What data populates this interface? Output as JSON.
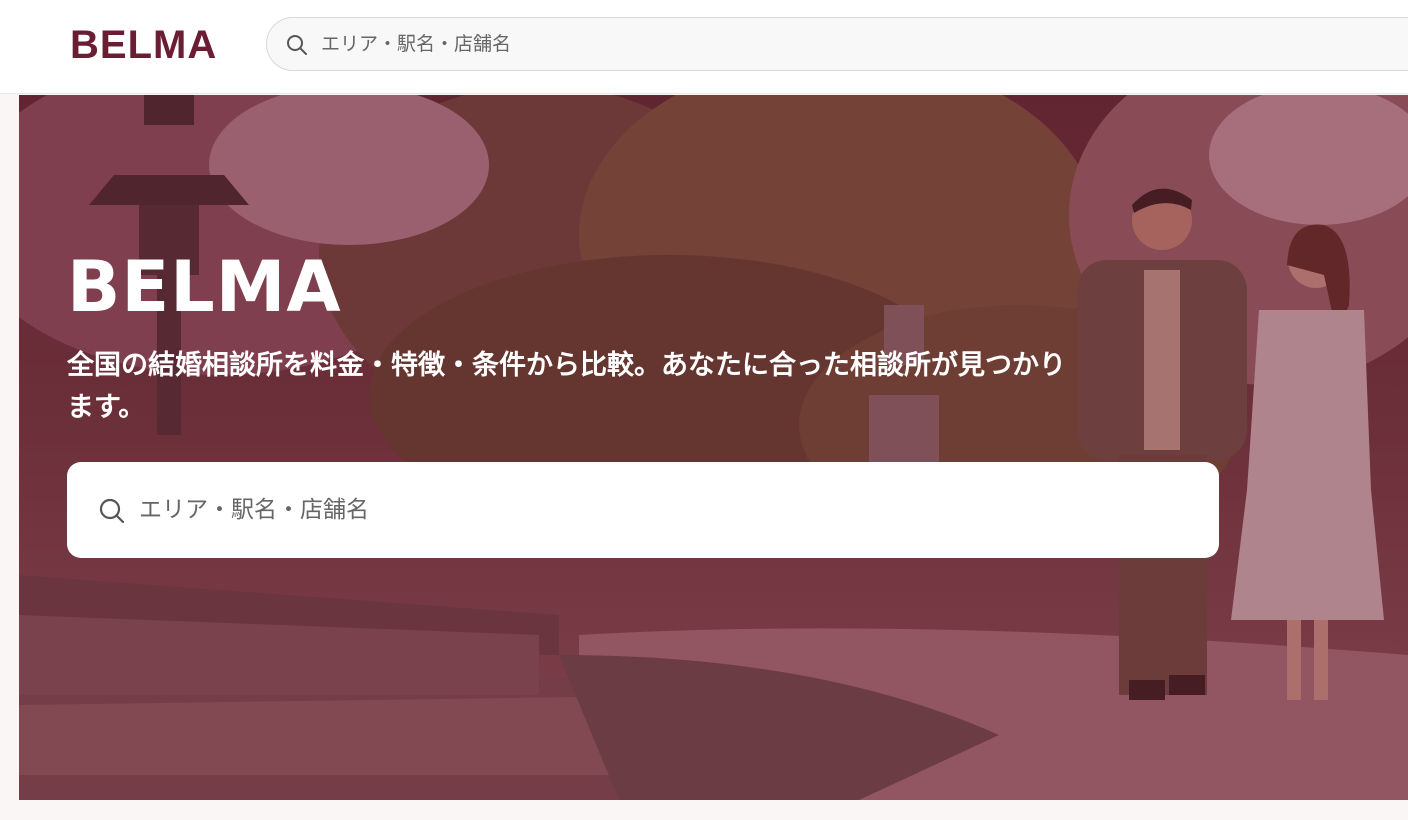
{
  "header": {
    "logo": "BELMA",
    "search": {
      "placeholder": "エリア・駅名・店舗名",
      "value": "",
      "icon": "search-icon"
    }
  },
  "hero": {
    "title": "BELMA",
    "subtitle": "全国の結婚相談所を料金・特徴・条件から比較。あなたに合った相談所が見つかります。",
    "search": {
      "placeholder": "エリア・駅名・店舗名",
      "value": "",
      "icon": "search-icon"
    },
    "image": "couple-walking-garden-photo"
  },
  "colors": {
    "brand": "#6b1d33",
    "overlay": "#6e1e32"
  }
}
